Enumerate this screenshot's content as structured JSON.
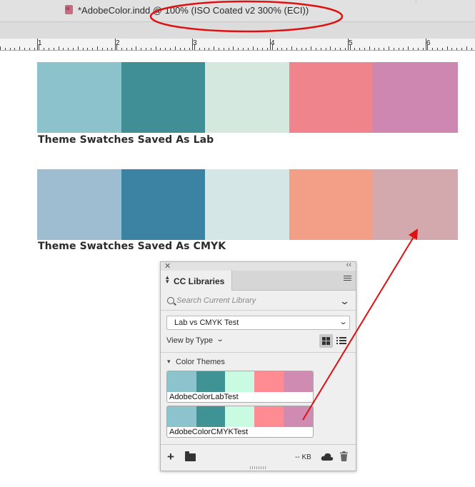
{
  "document_tab": {
    "title": "*AdobeColor.indd @ 100% (ISO Coated v2 300% (ECI))",
    "icon": "Id"
  },
  "ruler": {
    "labels": [
      "1",
      "2",
      "3",
      "4",
      "5",
      "6"
    ]
  },
  "swatch_rows": [
    {
      "caption": "Theme Swatches Saved As Lab",
      "colors": [
        "#8cc2cb",
        "#418f96",
        "#d5e8e0",
        "#ef848c",
        "#cd87b0"
      ]
    },
    {
      "caption": "Theme Swatches Saved As CMYK",
      "colors": [
        "#9ebdd1",
        "#3b82a3",
        "#d4e7e6",
        "#f39f88",
        "#d4a9ae"
      ]
    }
  ],
  "panel": {
    "tab_label": "CC Libraries",
    "search_placeholder": "Search Current Library",
    "library_selected": "Lab vs CMYK Test",
    "view_by_label": "View by Type",
    "section_label": "Color Themes",
    "themes": [
      {
        "name": "AdobeColorLabTest",
        "colors": [
          "#8cc3cc",
          "#3f9394",
          "#c8fbe2",
          "#ff8b93",
          "#cf8bb2"
        ]
      },
      {
        "name": "AdobeColorCMYKTest",
        "colors": [
          "#8cc3cc",
          "#3f9394",
          "#c8fbe2",
          "#ff8b93",
          "#cf8bb2"
        ]
      }
    ],
    "size_label": "-- KB"
  },
  "annotation_colors": {
    "ellipse": "#e01010",
    "arrow": "#e01010"
  }
}
